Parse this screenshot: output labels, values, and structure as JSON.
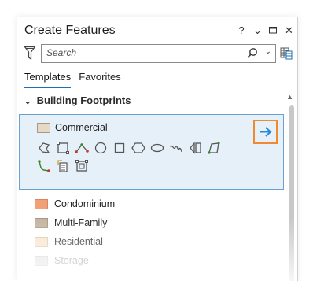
{
  "pane": {
    "title": "Create Features",
    "title_icons": [
      "help-icon",
      "pin-dropdown-icon",
      "maximize-icon",
      "close-icon"
    ],
    "title_glyphs": {
      "help": "?",
      "menu": "⌄",
      "close": "✕"
    }
  },
  "search": {
    "placeholder": "Search",
    "value": ""
  },
  "tabs": [
    {
      "label": "Templates",
      "active": true
    },
    {
      "label": "Favorites",
      "active": false
    }
  ],
  "group": {
    "chevron": "⌄",
    "label": "Building Footprints"
  },
  "selected_template": {
    "label": "Commercial",
    "swatch_color": "#e8d9c6",
    "tools": [
      "freehand-polygon-icon",
      "rectangle-select-icon",
      "polyline-icon",
      "circle-icon",
      "rectangle-icon",
      "hexagon-icon",
      "ellipse-icon",
      "freehand-icon",
      "split-shape-icon",
      "right-angle-polygon-icon",
      "trace-icon",
      "building-shape-icon",
      "auto-complete-polygon-icon"
    ],
    "action_icon": "arrow-right-icon"
  },
  "templates": [
    {
      "label": "Condominium",
      "swatch_color": "#f2a078"
    },
    {
      "label": "Multi-Family",
      "swatch_color": "#c4b3a0"
    },
    {
      "label": "Residential",
      "swatch_color": "#f7e3c8"
    },
    {
      "label": "Storage",
      "swatch_color": "#e2e2e2"
    }
  ],
  "colors": {
    "accent": "#1a6fb7",
    "selection_bg": "#e6f0f8",
    "selection_border": "#6aa0cf",
    "highlight_orange": "#f08a32",
    "tool_green": "#3a8a2a",
    "tool_red": "#c0392b"
  }
}
